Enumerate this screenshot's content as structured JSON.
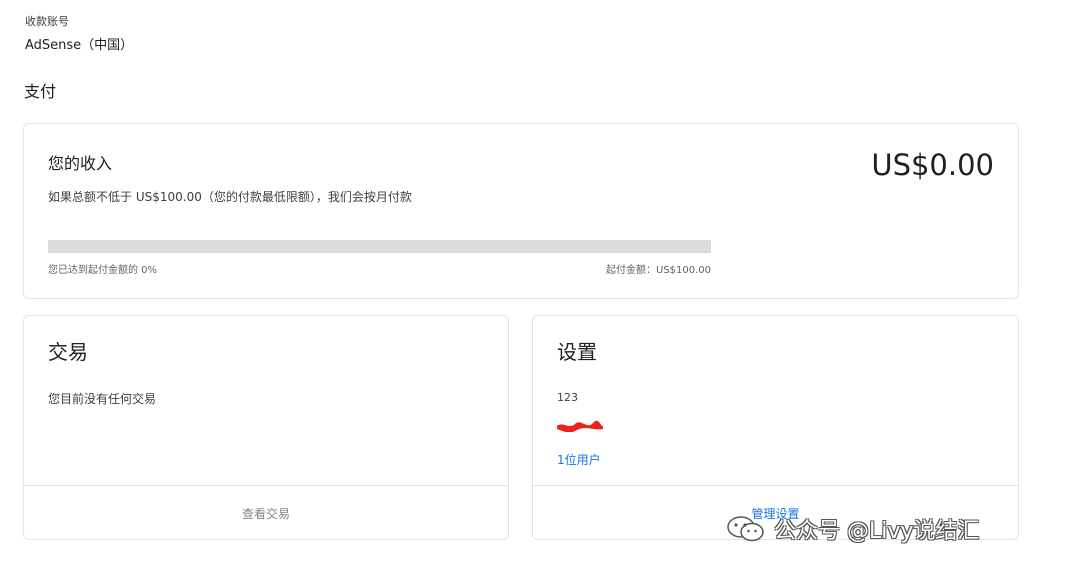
{
  "account": {
    "label": "收款账号",
    "name": "AdSense（中国）"
  },
  "section_title": "支付",
  "income": {
    "title": "您的收入",
    "description": "如果总额不低于 US$100.00（您的付款最低限额），我们会按月付款",
    "amount": "US$0.00",
    "progress_percent": 0,
    "progress_left": "您已达到起付金额的 0%",
    "progress_right": "起付金额：US$100.00"
  },
  "transactions": {
    "title": "交易",
    "empty_text": "您目前没有任何交易",
    "view_button": "查看交易"
  },
  "settings": {
    "title": "设置",
    "value": "123",
    "users_link": "1位用户",
    "manage_button": "管理设置"
  },
  "watermark": {
    "text": "公众号 @Livy说结汇",
    "icon": "wechat-icon"
  },
  "colors": {
    "accent": "#1a73e8",
    "track": "#dcdcdc",
    "redaction": "#e8241c"
  }
}
